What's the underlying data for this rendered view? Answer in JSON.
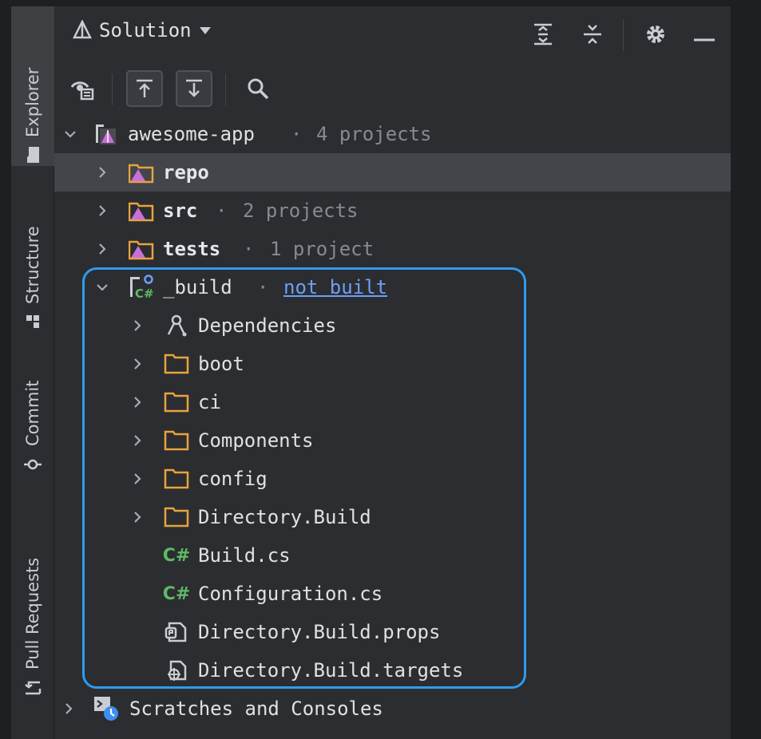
{
  "tool_strip": {
    "tabs": [
      {
        "label": "Explorer",
        "icon": "folder-icon",
        "active": true
      },
      {
        "label": "Structure",
        "icon": "structure-icon",
        "active": false
      },
      {
        "label": "Commit",
        "icon": "commit-icon",
        "active": false
      },
      {
        "label": "Pull Requests",
        "icon": "pull-request-icon",
        "active": false
      }
    ]
  },
  "header": {
    "title": "Solution",
    "actions": [
      "expand-all-icon",
      "collapse-all-icon",
      "gear-icon",
      "minimize-icon"
    ]
  },
  "toolbar": {
    "buttons": [
      "view-options-icon",
      "scroll-from-source-icon",
      "scroll-to-source-icon",
      "search-icon"
    ]
  },
  "tree": {
    "solution": {
      "name": "awesome-app",
      "sep": "·",
      "meta": "4 projects"
    },
    "folders": [
      {
        "name": "repo",
        "sep": "",
        "meta": ""
      },
      {
        "name": "src",
        "sep": "·",
        "meta": "2 projects"
      },
      {
        "name": "tests",
        "sep": "·",
        "meta": "1 project"
      }
    ],
    "project": {
      "name": "_build",
      "sep": "·",
      "status": "not built"
    },
    "children": [
      {
        "name": "Dependencies",
        "icon": "dependencies-icon",
        "expandable": true
      },
      {
        "name": "boot",
        "icon": "folder-icon",
        "expandable": true
      },
      {
        "name": "ci",
        "icon": "folder-icon",
        "expandable": true
      },
      {
        "name": "Components",
        "icon": "folder-icon",
        "expandable": true
      },
      {
        "name": "config",
        "icon": "folder-icon",
        "expandable": true
      },
      {
        "name": "Directory.Build",
        "icon": "folder-icon",
        "expandable": true
      },
      {
        "name": "Build.cs",
        "icon": "csharp-file-icon",
        "expandable": false
      },
      {
        "name": "Configuration.cs",
        "icon": "csharp-file-icon",
        "expandable": false
      },
      {
        "name": "Directory.Build.props",
        "icon": "props-file-icon",
        "expandable": false
      },
      {
        "name": "Directory.Build.targets",
        "icon": "targets-file-icon",
        "expandable": false
      }
    ],
    "scratches": {
      "name": "Scratches and Consoles"
    }
  },
  "colors": {
    "background": "#2b2d30",
    "selection": "#43454a",
    "folder": "#e8a33d",
    "csharp": "#5fb865",
    "link": "#6f9ef8",
    "highlight": "#2e9bf0"
  }
}
